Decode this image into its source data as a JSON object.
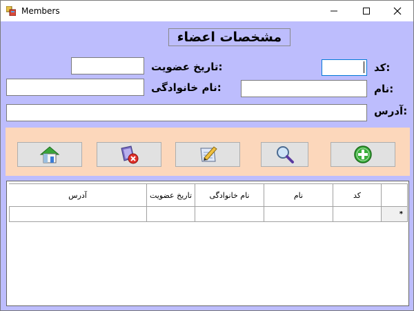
{
  "window": {
    "title": "Members"
  },
  "titlebar": {
    "minimize": "—",
    "maximize": "☐",
    "close": "✕"
  },
  "form": {
    "heading": "مشخصات اعضاء",
    "code_label": "کد:",
    "code_value": "",
    "name_label": "نام:",
    "name_value": "",
    "family_label": "نام خانوادگی:",
    "family_value": "",
    "date_label": "تاریخ عضویت:",
    "date_value": "",
    "address_label": "آدرس:",
    "address_value": ""
  },
  "toolbar": {
    "buttons": [
      {
        "icon": "home-icon"
      },
      {
        "icon": "delete-icon"
      },
      {
        "icon": "edit-icon"
      },
      {
        "icon": "search-icon"
      },
      {
        "icon": "add-icon"
      }
    ]
  },
  "grid": {
    "columns": [
      "آدرس",
      "تاریخ عضویت",
      "نام خانوادگی",
      "نام",
      "کد"
    ],
    "new_row_marker": "*"
  }
}
